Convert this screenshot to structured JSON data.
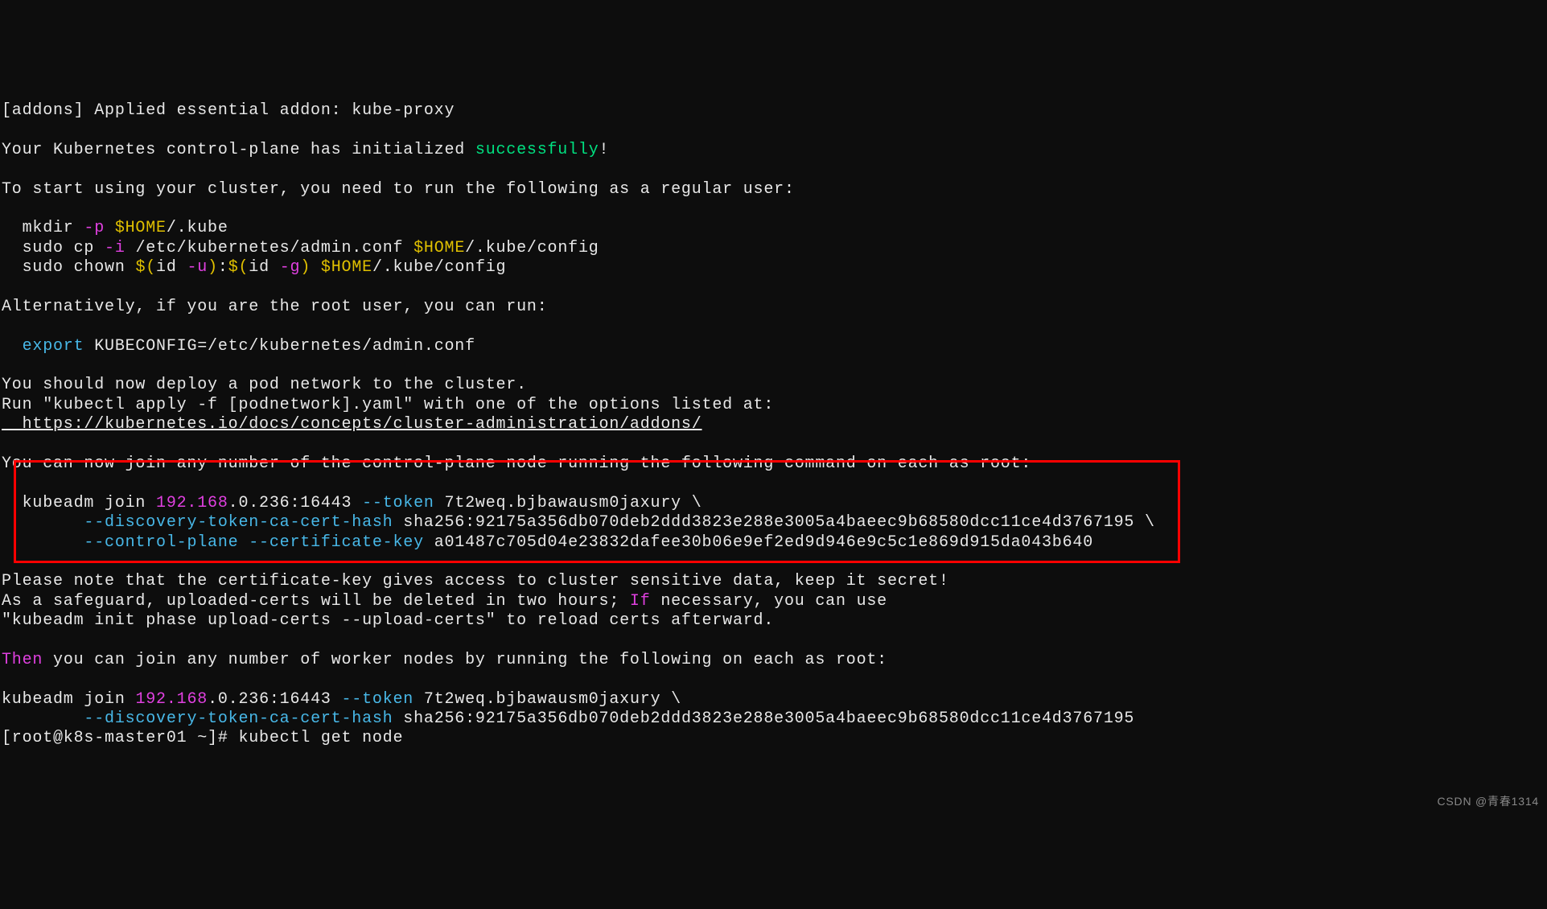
{
  "lines": {
    "l1": "[addons] Applied essential addon: kube-proxy",
    "l2a": "Your Kubernetes control-plane has initialized ",
    "l2b": "successfully",
    "l2c": "!",
    "l3": "To start using your cluster, you need to run the following as a regular user:",
    "l4a": "  mkdir ",
    "l4b": "-p",
    "l4c": " $HOME",
    "l4d": "/.kube",
    "l5a": "  sudo cp ",
    "l5b": "-i",
    "l5c": " /etc/kubernetes/admin.conf ",
    "l5d": "$HOME",
    "l5e": "/.kube/config",
    "l6a": "  sudo chown ",
    "l6b": "$(",
    "l6c": "id ",
    "l6d": "-u",
    "l6e": ")",
    "l6f": ":",
    "l6g": "$(",
    "l6h": "id ",
    "l6i": "-g",
    "l6j": ")",
    "l6k": " $HOME",
    "l6l": "/.kube/config",
    "l7": "Alternatively, if you are the root user, you can run:",
    "l8a": "  export",
    "l8b": " KUBECONFIG=/etc/kubernetes/admin.conf",
    "l9": "You should now deploy a pod network to the cluster.",
    "l10": "Run \"kubectl apply -f [podnetwork].yaml\" with one of the options listed at:",
    "l11": "  https://kubernetes.io/docs/concepts/cluster-administration/addons/",
    "l12": "You can now join any number of the control-plane node running the following command on each as root:",
    "l13a": "  kubeadm join ",
    "l13b": "192.168",
    "l13c": ".0.236:16443 ",
    "l13d": "--token",
    "l13e": " 7t2weq.bjbawausm0jaxury \\",
    "l14a": "        ",
    "l14b": "--discovery-token-ca-cert-hash",
    "l14c": " sha256:92175a356db070deb2ddd3823e288e3005a4baeec9b68580dcc11ce4d3767195 \\",
    "l15a": "        ",
    "l15b": "--control-plane --certificate-key",
    "l15c": " a01487c705d04e23832dafee30b06e9ef2ed9d946e9c5c1e869d915da043b640",
    "l16": "Please note that the certificate-key gives access to cluster sensitive data, keep it secret!",
    "l17a": "As a safeguard, uploaded-certs will be deleted in two hours; ",
    "l17b": "If",
    "l17c": " necessary, you can use",
    "l18": "\"kubeadm init phase upload-certs --upload-certs\" to reload certs afterward.",
    "l19a": "Then",
    "l19b": " you can join any number of worker nodes by running the following on each as root:",
    "l20a": "kubeadm join ",
    "l20b": "192.168",
    "l20c": ".0.236:16443 ",
    "l20d": "--token",
    "l20e": " 7t2weq.bjbawausm0jaxury \\",
    "l21a": "        ",
    "l21b": "--discovery-token-ca-cert-hash",
    "l21c": " sha256:92175a356db070deb2ddd3823e288e3005a4baeec9b68580dcc11ce4d3767195 ",
    "l22a": "[root@k8s-master01 ~]# ",
    "l22b": "kubectl get node"
  },
  "watermark": "CSDN @青春1314"
}
